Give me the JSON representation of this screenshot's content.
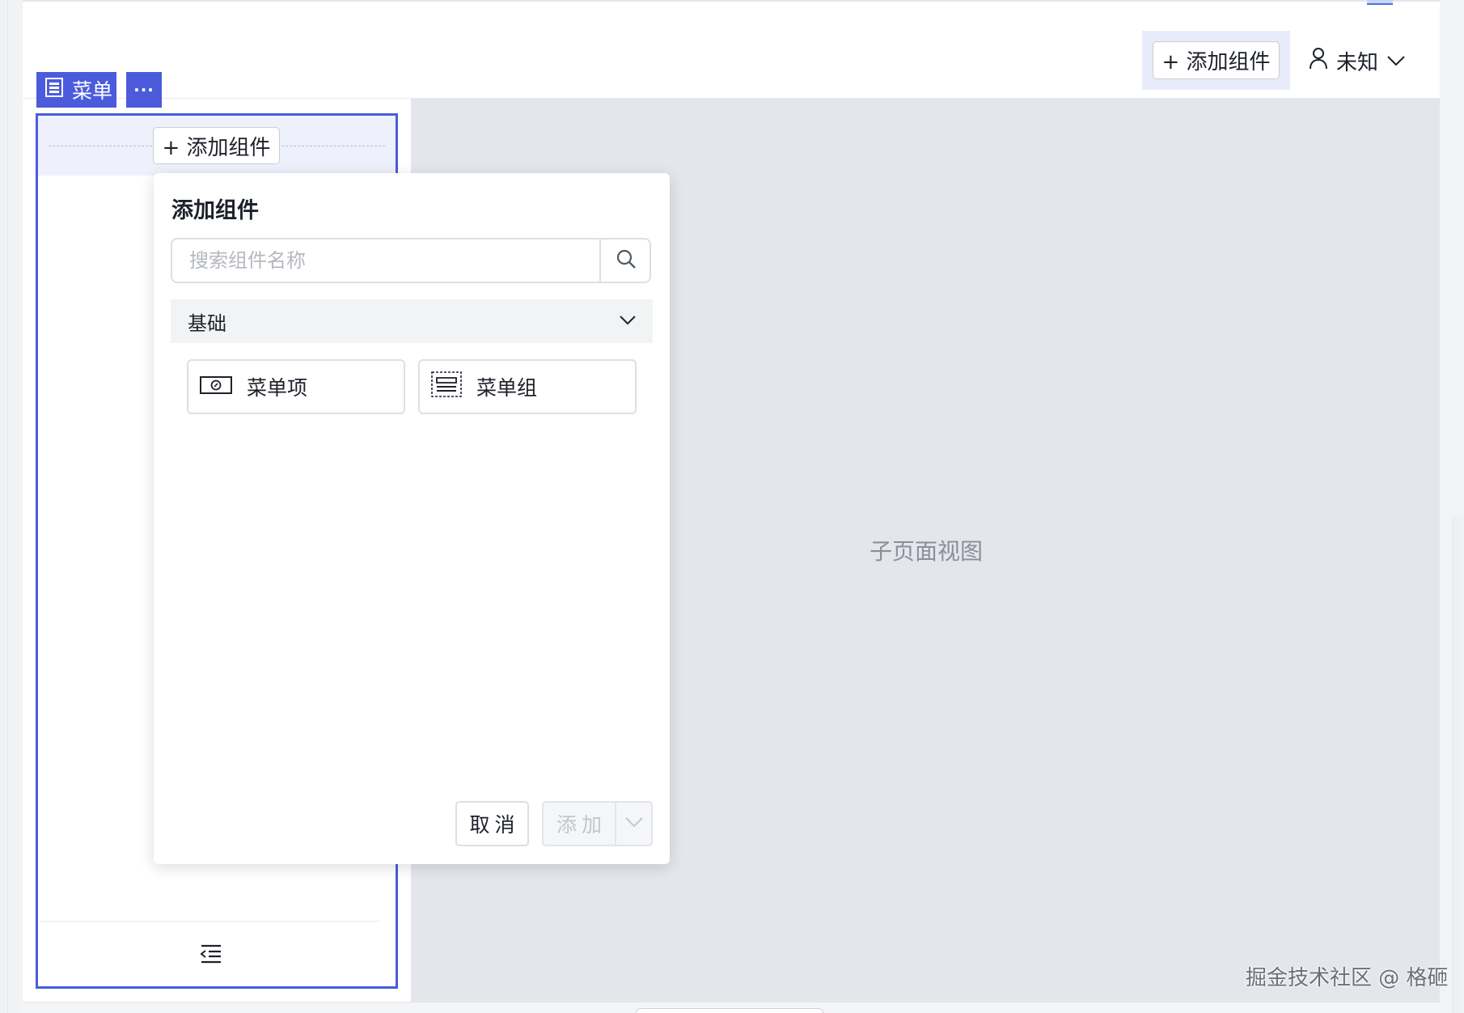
{
  "header": {
    "add_component_label": "+ 添加组件",
    "user_label": "未知"
  },
  "menu_tag": {
    "label": "菜单",
    "more_label": "···"
  },
  "menu_panel": {
    "add_component_label": "+ 添加组件"
  },
  "content": {
    "subpage_label": "子页面视图"
  },
  "popover": {
    "title": "添加组件",
    "search_placeholder": "搜索组件名称",
    "category": "基础",
    "components": [
      {
        "label": "菜单项",
        "icon": "menu-item-icon"
      },
      {
        "label": "菜单组",
        "icon": "menu-group-icon"
      }
    ],
    "cancel_label": "取消",
    "add_label": "添加"
  },
  "watermark": "掘金技术社区 @ 格砸",
  "colors": {
    "accent": "#4b5bdc",
    "content_bg": "#e4e6ec",
    "disabled_text": "#c2c6cc"
  }
}
